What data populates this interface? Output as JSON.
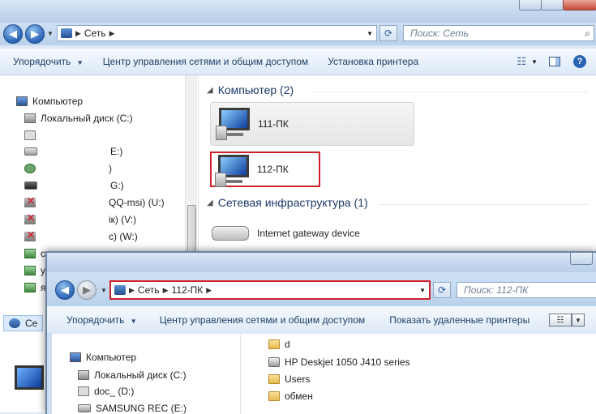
{
  "back_window": {
    "address": {
      "crumb1": "Сеть"
    },
    "search": {
      "placeholder": "Поиск: Сеть"
    },
    "toolbar": {
      "organize": "Упорядочить",
      "network_center": "Центр управления сетями и общим доступом",
      "install_printer": "Установка принтера"
    },
    "sidebar": {
      "computer": "Компьютер",
      "items": [
        {
          "label": "Локальный диск (C:)"
        },
        {
          "label": ""
        },
        {
          "label": "E:)"
        },
        {
          "label": ")"
        },
        {
          "label": "G:)"
        },
        {
          "label": "QQ-msi) (U:)"
        },
        {
          "label": "iк) (V:)"
        },
        {
          "label": "c) (W:)"
        },
        {
          "label": "c"
        },
        {
          "label": "y"
        },
        {
          "label": "я"
        }
      ],
      "bottom_item": "Се"
    },
    "groups": {
      "computers_header": "Компьютер (2)",
      "computers": [
        {
          "name": "111-ПК"
        },
        {
          "name": "112-ПК"
        }
      ],
      "infra_header": "Сетевая инфраструктура (1)",
      "gateway": "Internet gateway device"
    }
  },
  "front_window": {
    "address": {
      "crumb1": "Сеть",
      "crumb2": "112-ПК"
    },
    "search": {
      "placeholder": "Поиск: 112-ПК"
    },
    "toolbar": {
      "organize": "Упорядочить",
      "network_center": "Центр управления сетями и общим доступом",
      "show_printers": "Показать удаленные принтеры"
    },
    "sidebar": {
      "computer": "Компьютер",
      "items": [
        {
          "label": "Локальный диск (C:)"
        },
        {
          "label": "doc_ (D:)"
        },
        {
          "label": "SAMSUNG REC (E:)"
        }
      ]
    },
    "shares": [
      {
        "name": "d"
      },
      {
        "name": "HP Deskjet 1050 J410 series"
      },
      {
        "name": "Users"
      },
      {
        "name": "обмен"
      }
    ]
  },
  "colors": {
    "highlight_red": "#d0202a",
    "link_blue": "#1e3f66"
  }
}
